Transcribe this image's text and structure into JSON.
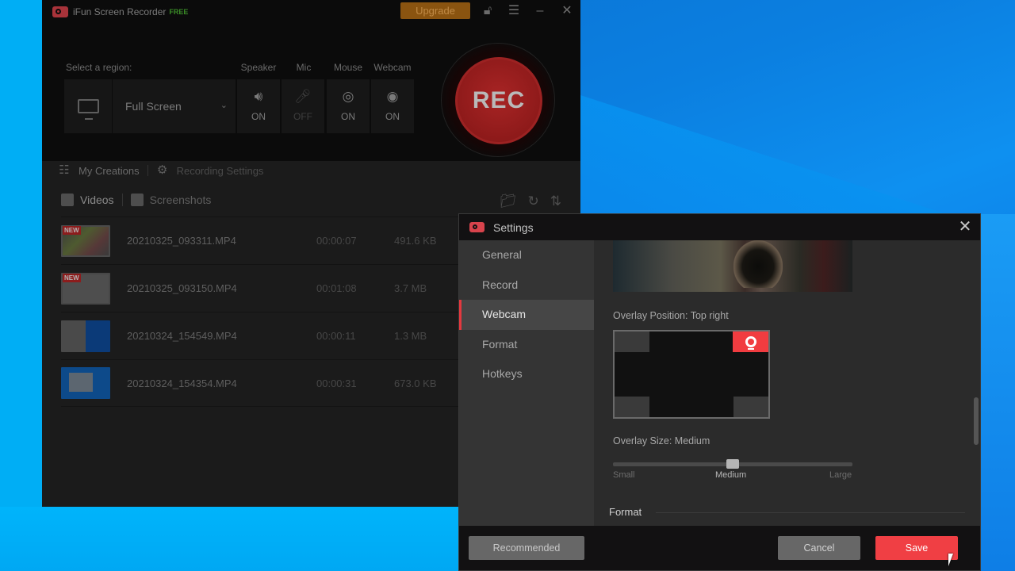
{
  "main_window": {
    "app_title": "iFun Screen Recorder",
    "edition_badge": "FREE",
    "upgrade_label": "Upgrade",
    "titlebar_icons": [
      "lock-icon",
      "menu-icon",
      "minimize-icon",
      "close-icon"
    ],
    "select_region_label": "Select a region:",
    "region_value": "Full Screen",
    "devices": [
      {
        "label": "Speaker",
        "state": "ON",
        "icon": "speaker-icon"
      },
      {
        "label": "Mic",
        "state": "OFF",
        "icon": "mic-icon"
      },
      {
        "label": "Mouse",
        "state": "ON",
        "icon": "mouse-click-icon"
      },
      {
        "label": "Webcam",
        "state": "ON",
        "icon": "webcam-icon"
      }
    ],
    "rec_label": "REC",
    "nav": {
      "my_creations": "My Creations",
      "recording_settings": "Recording Settings"
    },
    "tabs": {
      "videos": "Videos",
      "screenshots": "Screenshots"
    },
    "list_actions": [
      "folder-icon",
      "refresh-icon",
      "sort-icon"
    ],
    "files": [
      {
        "name": "20210325_093311.MP4",
        "duration": "00:00:07",
        "size": "491.6 KB",
        "badge": "NEW"
      },
      {
        "name": "20210325_093150.MP4",
        "duration": "00:01:08",
        "size": "3.7 MB",
        "badge": "NEW"
      },
      {
        "name": "20210324_154549.MP4",
        "duration": "00:00:11",
        "size": "1.3 MB",
        "badge": ""
      },
      {
        "name": "20210324_154354.MP4",
        "duration": "00:00:31",
        "size": "673.0 KB",
        "badge": ""
      }
    ]
  },
  "settings": {
    "title": "Settings",
    "sidebar": [
      {
        "label": "General",
        "active": false
      },
      {
        "label": "Record",
        "active": false
      },
      {
        "label": "Webcam",
        "active": true
      },
      {
        "label": "Format",
        "active": false
      },
      {
        "label": "Hotkeys",
        "active": false
      }
    ],
    "overlay_position_label": "Overlay Position: Top right",
    "overlay_position": "Top right",
    "overlay_size_label": "Overlay Size: Medium",
    "overlay_size_options": [
      "Small",
      "Medium",
      "Large"
    ],
    "overlay_size_value": "Medium",
    "overlay_size_fraction": 0.5,
    "section_format": "Format",
    "buttons": {
      "recommended": "Recommended",
      "cancel": "Cancel",
      "save": "Save"
    }
  },
  "colors": {
    "accent_red": "#f03f44",
    "upgrade_orange": "#8a5410",
    "free_green": "#3a8b27"
  }
}
